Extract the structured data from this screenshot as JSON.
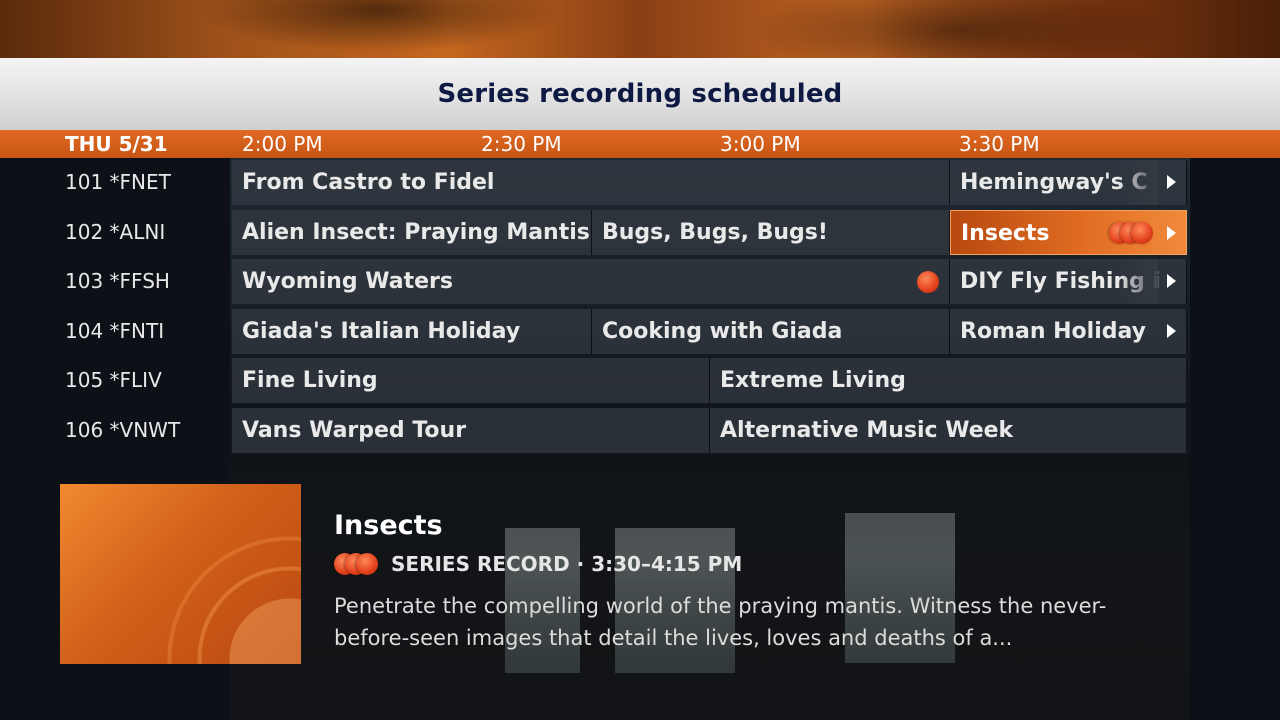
{
  "banner": {
    "message": "Series recording scheduled"
  },
  "timebar": {
    "date": "THU 5/31",
    "slots": [
      "2:00 PM",
      "2:30 PM",
      "3:00 PM",
      "3:30 PM"
    ]
  },
  "rows": [
    {
      "channel": "101 *FNET",
      "programs": [
        "From Castro to Fidel",
        "Hemingway's C"
      ]
    },
    {
      "channel": "102 *ALNI",
      "programs": [
        "Alien Insect: Praying Mantis",
        "Bugs, Bugs, Bugs!",
        "Insects"
      ]
    },
    {
      "channel": "103 *FFSH",
      "programs": [
        "Wyoming Waters",
        "DIY Fly Fishing i"
      ]
    },
    {
      "channel": "104 *FNTI",
      "programs": [
        "Giada's Italian Holiday",
        "Cooking with Giada",
        "Roman Holiday"
      ]
    },
    {
      "channel": "105 *FLIV",
      "programs": [
        "Fine Living",
        "Extreme Living"
      ]
    },
    {
      "channel": "106 *VNWT",
      "programs": [
        "Vans Warped Tour",
        "Alternative Music Week"
      ]
    }
  ],
  "detail": {
    "title": "Insects",
    "meta": "SERIES RECORD  ·  3:30–4:15 PM",
    "description": "Penetrate the compelling world of the praying mantis. Witness the never-before-seen images that detail the lives, loves and deaths of a..."
  },
  "icons": {
    "record": "record-dot-icon",
    "series_record": "series-record-icon",
    "more": "chevron-right-icon"
  },
  "colors": {
    "accent_orange": "#e06a22",
    "banner_text": "#0e1a44",
    "cell_bg": "#343a42",
    "record_red": "#e2401c"
  }
}
